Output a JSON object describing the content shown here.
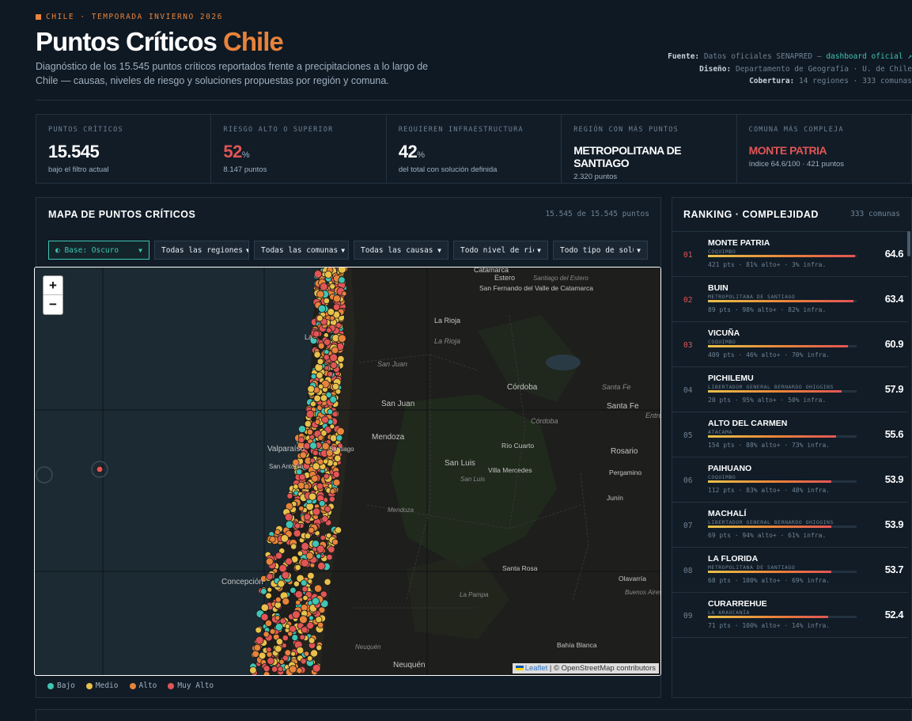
{
  "header": {
    "eyebrow": "CHILE · TEMPORADA INVIERNO 2026",
    "title_main": "Puntos Críticos",
    "title_accent": "Chile",
    "subtitle": "Diagnóstico de los 15.545 puntos críticos reportados frente a precipitaciones a lo largo de Chile — causas, niveles de riesgo y soluciones propuestas por región y comuna.",
    "meta": {
      "source_label": "Fuente:",
      "source_text": "Datos oficiales SENAPRED —",
      "source_link": "dashboard oficial ↗",
      "design_label": "Diseño:",
      "design_text": "Departamento de Geografía · U. de Chile",
      "coverage_label": "Cobertura:",
      "coverage_text": "14 regiones · 333 comunas"
    }
  },
  "stats": [
    {
      "label": "PUNTOS CRÍTICOS",
      "value": "15.545",
      "unit": "",
      "note": "bajo el filtro actual"
    },
    {
      "label": "RIESGO ALTO O SUPERIOR",
      "value": "52",
      "unit": "%",
      "note": "8.147 puntos"
    },
    {
      "label": "REQUIEREN INFRAESTRUCTURA",
      "value": "42",
      "unit": "%",
      "note": "del total con solución definida"
    },
    {
      "label": "REGIÓN CON MÁS PUNTOS",
      "value": "METROPOLITANA DE SANTIAGO",
      "unit": "",
      "note": "2.320 puntos"
    },
    {
      "label": "COMUNA MÁS COMPLEJA",
      "value": "MONTE PATRIA",
      "unit": "",
      "note": "índice 64.6/100 · 421 puntos"
    }
  ],
  "map_panel": {
    "title": "MAPA DE PUNTOS CRÍTICOS",
    "count": "15.545 de 15.545 puntos",
    "filters": {
      "base": "◐ Base: Oscuro",
      "regions": "Todas las regiones",
      "communes": "Todas las comunas",
      "causes": "Todas las causas",
      "risk": "Todo nivel de riesgo",
      "solution": "Todo tipo de solución"
    },
    "zoom_in": "+",
    "zoom_out": "−",
    "attribution_leaflet": "Leaflet",
    "attribution_osm": "| © OpenStreetMap contributors",
    "places": {
      "estero": "Estero",
      "santiago_estero": "Santiago del Estero",
      "catamarca": "San Fernando del Valle de Catamarca",
      "la_rioja": "La Rioja",
      "la_rioja2": "La Rioja",
      "la_serena": "La",
      "san_juan_prov": "San Juan",
      "cordoba": "Córdoba",
      "cordoba_prov": "Córdoba",
      "santa_fe_prov": "Santa Fe",
      "santa_fe": "Santa Fe",
      "entre": "Entre",
      "san_juan": "San Juan",
      "mendoza": "Mendoza",
      "valparaiso": "Valparaíso",
      "san_antonio": "San Antonio",
      "santiago": "Santiago",
      "san_luis": "San Luis",
      "san_luis_prov": "San Luis",
      "rio_cuarto": "Río Cuarto",
      "villa_mercedes": "Villa Mercedes",
      "rosario": "Rosario",
      "pergamino": "Pergamino",
      "junin": "Junín",
      "mendoza_prov": "Mendoza",
      "santa_rosa": "Santa Rosa",
      "olavarria": "Olavarría",
      "buenos_aires": "Buenos Aires",
      "la_pampa": "La Pampa",
      "concepcion": "Concepción",
      "bahia_blanca": "Bahía Blanca",
      "neuquen_prov": "Neuquén",
      "neuquen": "Neuquén",
      "catamarca_top": "Catamarca"
    }
  },
  "legend": [
    {
      "label": "Bajo",
      "color": "#3fc5b4"
    },
    {
      "label": "Medio",
      "color": "#e8c14a"
    },
    {
      "label": "Alto",
      "color": "#e8833a"
    },
    {
      "label": "Muy Alto",
      "color": "#e25555"
    }
  ],
  "ranking": {
    "title": "RANKING · COMPLEJIDAD",
    "count": "333 comunas",
    "items": [
      {
        "rank": "01",
        "name": "MONTE PATRIA",
        "region": "COQUIMBO",
        "stats": "421 pts · 81% alto+ · 3% infra.",
        "score": "64.6",
        "fill": 0.99
      },
      {
        "rank": "02",
        "name": "BUIN",
        "region": "METROPOLITANA DE SANTIAGO",
        "stats": "89 pts · 98% alto+ · 82% infra.",
        "score": "63.4",
        "fill": 0.98
      },
      {
        "rank": "03",
        "name": "VICUÑA",
        "region": "COQUIMBO",
        "stats": "409 pts · 46% alto+ · 70% infra.",
        "score": "60.9",
        "fill": 0.94
      },
      {
        "rank": "04",
        "name": "PICHILEMU",
        "region": "LIBERTADOR GENERAL BERNARDO OHIGGINS",
        "stats": "20 pts · 95% alto+ · 50% infra.",
        "score": "57.9",
        "fill": 0.9
      },
      {
        "rank": "05",
        "name": "ALTO DEL CARMEN",
        "region": "ATACAMA",
        "stats": "154 pts · 88% alto+ · 73% infra.",
        "score": "55.6",
        "fill": 0.86
      },
      {
        "rank": "06",
        "name": "PAIHUANO",
        "region": "COQUIMBO",
        "stats": "112 pts · 83% alto+ · 48% infra.",
        "score": "53.9",
        "fill": 0.83
      },
      {
        "rank": "07",
        "name": "MACHALÍ",
        "region": "LIBERTADOR GENERAL BERNARDO OHIGGINS",
        "stats": "69 pts · 94% alto+ · 61% infra.",
        "score": "53.9",
        "fill": 0.83
      },
      {
        "rank": "08",
        "name": "LA FLORIDA",
        "region": "METROPOLITANA DE SANTIAGO",
        "stats": "68 pts · 100% alto+ · 69% infra.",
        "score": "53.7",
        "fill": 0.83
      },
      {
        "rank": "09",
        "name": "CURARREHUE",
        "region": "LA ARAUCANÍA",
        "stats": "71 pts · 100% alto+ · 14% infra.",
        "score": "52.4",
        "fill": 0.81
      }
    ]
  }
}
